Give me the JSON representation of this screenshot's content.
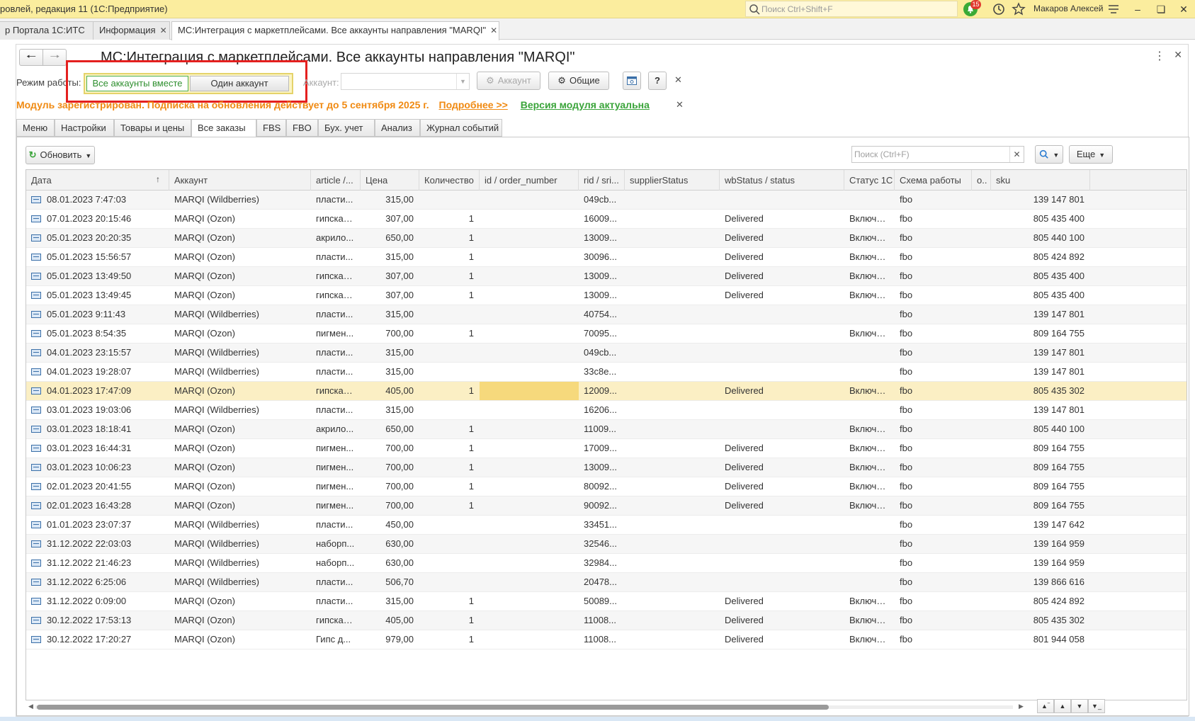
{
  "titlebar": {
    "app_title": "ровлей, редакция 11  (1С:Предприятие)",
    "search_placeholder": "Поиск Ctrl+Shift+F",
    "notifications_count": "15",
    "user_name": "Макаров Алексей",
    "icons": [
      "search-icon",
      "bell-icon",
      "history-icon",
      "star-icon",
      "menu-icon",
      "minimize-icon",
      "restore-icon",
      "close-icon"
    ]
  },
  "tabs": [
    {
      "label": "р Портала 1С:ИТС",
      "active": false
    },
    {
      "label": "Информация",
      "active": false
    },
    {
      "label": "МС:Интеграция с маркетплейсами. Все аккаунты направления \"MARQI\"",
      "active": true
    }
  ],
  "form": {
    "title": "МС:Интеграция с маркетплейсами. Все аккаунты направления \"MARQI\"",
    "mode_label": "Режим работы:",
    "mode_all": "Все аккаунты вместе",
    "mode_one": "Один аккаунт",
    "account_label": "Аккаунт:",
    "account_value": "",
    "account_btn": "Аккаунт",
    "common_btn": "Общие",
    "help_btn": "?",
    "notice_registered": "Модуль зарегистрирован. Подписка на обновления действует до 5 сентября 2025 г.",
    "notice_more": "Подробнее >>",
    "notice_version": "Версия модуля актуальна"
  },
  "inner_tabs": [
    {
      "label": "Меню",
      "active": false
    },
    {
      "label": "Настройки",
      "active": false
    },
    {
      "label": "Товары и цены",
      "active": false
    },
    {
      "label": "Все заказы",
      "active": true
    },
    {
      "label": "FBS",
      "active": false
    },
    {
      "label": "FBO",
      "active": false
    },
    {
      "label": "Бух. учет",
      "active": false
    },
    {
      "label": "Анализ",
      "active": false
    },
    {
      "label": "Журнал событий",
      "active": false
    }
  ],
  "toolbar": {
    "refresh": "Обновить",
    "search_placeholder": "Поиск (Ctrl+F)",
    "more": "Еще"
  },
  "table": {
    "columns": [
      "Дата",
      "Аккаунт",
      "article /...",
      "Цена",
      "Количество",
      "id / order_number",
      "rid / sri...",
      "supplierStatus",
      "wbStatus / status",
      "Статус 1С",
      "Схема работы",
      "о..",
      "sku"
    ],
    "sort_column": "Дата",
    "sort_dir": "asc",
    "rows": [
      [
        "08.01.2023 7:47:03",
        "MARQI (Wildberries)",
        "пласти...",
        "315,00",
        "",
        "",
        "049cb...",
        "",
        "",
        "",
        "fbo",
        "",
        "139 147 801"
      ],
      [
        "07.01.2023 20:15:46",
        "MARQI (Ozon)",
        "гипскак...",
        "307,00",
        "1",
        "",
        "16009...",
        "",
        "Delivered",
        "Включе...",
        "fbo",
        "",
        "805 435 400"
      ],
      [
        "05.01.2023 20:20:35",
        "MARQI (Ozon)",
        "акрило...",
        "650,00",
        "1",
        "",
        "13009...",
        "",
        "Delivered",
        "Включе...",
        "fbo",
        "",
        "805 440 100"
      ],
      [
        "05.01.2023 15:56:57",
        "MARQI (Ozon)",
        "пласти...",
        "315,00",
        "1",
        "",
        "30096...",
        "",
        "Delivered",
        "Включе...",
        "fbo",
        "",
        "805 424 892"
      ],
      [
        "05.01.2023 13:49:50",
        "MARQI (Ozon)",
        "гипскак...",
        "307,00",
        "1",
        "",
        "13009...",
        "",
        "Delivered",
        "Включе...",
        "fbo",
        "",
        "805 435 400"
      ],
      [
        "05.01.2023 13:49:45",
        "MARQI (Ozon)",
        "гипскак...",
        "307,00",
        "1",
        "",
        "13009...",
        "",
        "Delivered",
        "Включе...",
        "fbo",
        "",
        "805 435 400"
      ],
      [
        "05.01.2023 9:11:43",
        "MARQI (Wildberries)",
        "пласти...",
        "315,00",
        "",
        "",
        "40754...",
        "",
        "",
        "",
        "fbo",
        "",
        "139 147 801"
      ],
      [
        "05.01.2023 8:54:35",
        "MARQI (Ozon)",
        "пигмен...",
        "700,00",
        "1",
        "",
        "70095...",
        "",
        "",
        "Включе...",
        "fbo",
        "",
        "809 164 755"
      ],
      [
        "04.01.2023 23:15:57",
        "MARQI (Wildberries)",
        "пласти...",
        "315,00",
        "",
        "",
        "049cb...",
        "",
        "",
        "",
        "fbo",
        "",
        "139 147 801"
      ],
      [
        "04.01.2023 19:28:07",
        "MARQI (Wildberries)",
        "пласти...",
        "315,00",
        "",
        "",
        "33c8e...",
        "",
        "",
        "",
        "fbo",
        "",
        "139 147 801"
      ],
      [
        "04.01.2023 17:47:09",
        "MARQI (Ozon)",
        "гипскак...",
        "405,00",
        "1",
        "",
        "12009...",
        "",
        "Delivered",
        "Включе...",
        "fbo",
        "",
        "805 435 302"
      ],
      [
        "03.01.2023 19:03:06",
        "MARQI (Wildberries)",
        "пласти...",
        "315,00",
        "",
        "",
        "16206...",
        "",
        "",
        "",
        "fbo",
        "",
        "139 147 801"
      ],
      [
        "03.01.2023 18:18:41",
        "MARQI (Ozon)",
        "акрило...",
        "650,00",
        "1",
        "",
        "11009...",
        "",
        "",
        "Включе...",
        "fbo",
        "",
        "805 440 100"
      ],
      [
        "03.01.2023 16:44:31",
        "MARQI (Ozon)",
        "пигмен...",
        "700,00",
        "1",
        "",
        "17009...",
        "",
        "Delivered",
        "Включе...",
        "fbo",
        "",
        "809 164 755"
      ],
      [
        "03.01.2023 10:06:23",
        "MARQI (Ozon)",
        "пигмен...",
        "700,00",
        "1",
        "",
        "13009...",
        "",
        "Delivered",
        "Включе...",
        "fbo",
        "",
        "809 164 755"
      ],
      [
        "02.01.2023 20:41:55",
        "MARQI (Ozon)",
        "пигмен...",
        "700,00",
        "1",
        "",
        "80092...",
        "",
        "Delivered",
        "Включе...",
        "fbo",
        "",
        "809 164 755"
      ],
      [
        "02.01.2023 16:43:28",
        "MARQI (Ozon)",
        "пигмен...",
        "700,00",
        "1",
        "",
        "90092...",
        "",
        "Delivered",
        "Включе...",
        "fbo",
        "",
        "809 164 755"
      ],
      [
        "01.01.2023 23:07:37",
        "MARQI (Wildberries)",
        "пласти...",
        "450,00",
        "",
        "",
        "33451...",
        "",
        "",
        "",
        "fbo",
        "",
        "139 147 642"
      ],
      [
        "31.12.2022 22:03:03",
        "MARQI (Wildberries)",
        "наборп...",
        "630,00",
        "",
        "",
        "32546...",
        "",
        "",
        "",
        "fbo",
        "",
        "139 164 959"
      ],
      [
        "31.12.2022 21:46:23",
        "MARQI (Wildberries)",
        "наборп...",
        "630,00",
        "",
        "",
        "32984...",
        "",
        "",
        "",
        "fbo",
        "",
        "139 164 959"
      ],
      [
        "31.12.2022 6:25:06",
        "MARQI (Wildberries)",
        "пласти...",
        "506,70",
        "",
        "",
        "20478...",
        "",
        "",
        "",
        "fbo",
        "",
        "139 866 616"
      ],
      [
        "31.12.2022 0:09:00",
        "MARQI (Ozon)",
        "пласти...",
        "315,00",
        "1",
        "",
        "50089...",
        "",
        "Delivered",
        "Включе...",
        "fbo",
        "",
        "805 424 892"
      ],
      [
        "30.12.2022 17:53:13",
        "MARQI (Ozon)",
        "гипскак...",
        "405,00",
        "1",
        "",
        "11008...",
        "",
        "Delivered",
        "Включе...",
        "fbo",
        "",
        "805 435 302"
      ],
      [
        "30.12.2022 17:20:27",
        "MARQI (Ozon)",
        "Гипс д...",
        "979,00",
        "1",
        "",
        "11008...",
        "",
        "Delivered",
        "Включе...",
        "fbo",
        "",
        "801 944 058"
      ]
    ],
    "selected_row": 10
  }
}
